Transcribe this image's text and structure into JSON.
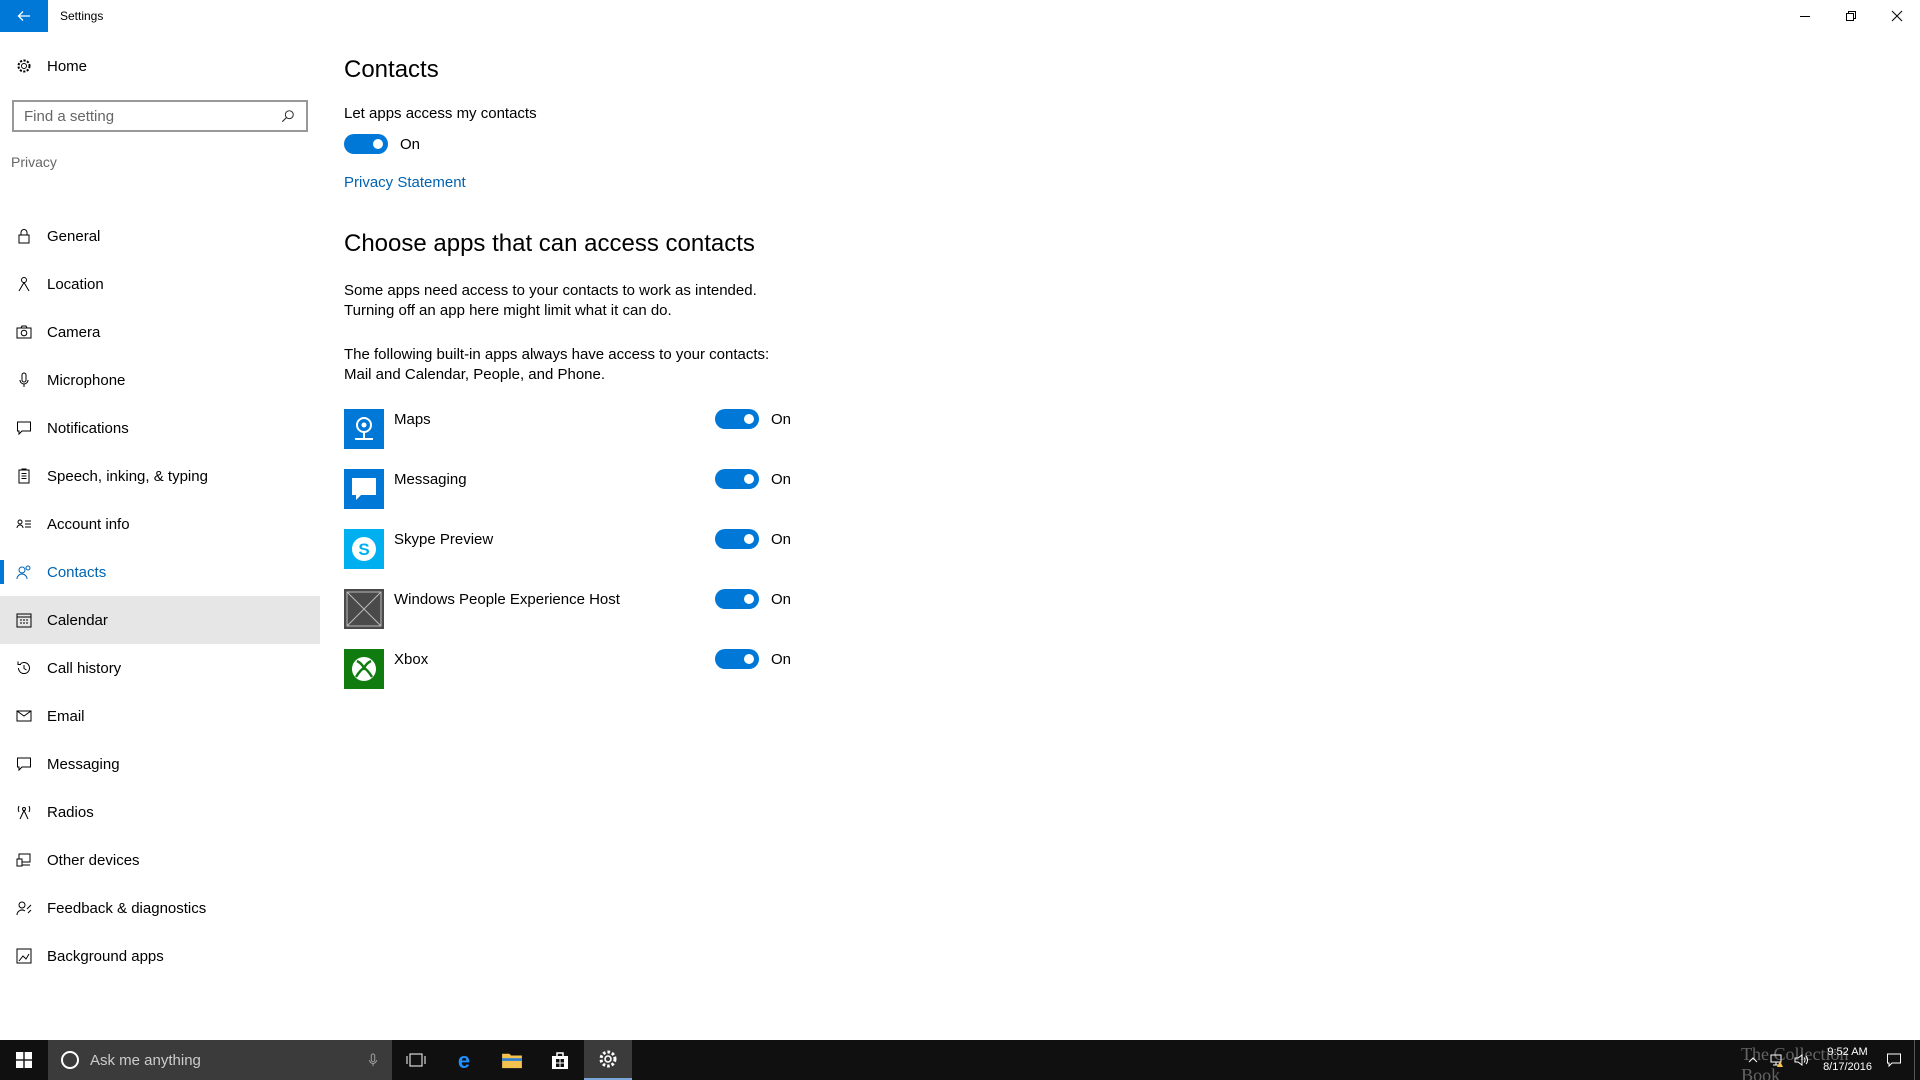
{
  "window": {
    "title": "Settings"
  },
  "sidebar": {
    "home_label": "Home",
    "search_placeholder": "Find a setting",
    "section_label": "Privacy",
    "items": [
      {
        "label": "General",
        "icon": "lock-icon"
      },
      {
        "label": "Location",
        "icon": "location-icon"
      },
      {
        "label": "Camera",
        "icon": "camera-icon"
      },
      {
        "label": "Microphone",
        "icon": "microphone-icon"
      },
      {
        "label": "Notifications",
        "icon": "notifications-icon"
      },
      {
        "label": "Speech, inking, & typing",
        "icon": "clipboard-icon"
      },
      {
        "label": "Account info",
        "icon": "account-info-icon"
      },
      {
        "label": "Contacts",
        "icon": "contacts-icon",
        "selected": true
      },
      {
        "label": "Calendar",
        "icon": "calendar-icon",
        "hovered": true
      },
      {
        "label": "Call history",
        "icon": "history-icon"
      },
      {
        "label": "Email",
        "icon": "mail-icon"
      },
      {
        "label": "Messaging",
        "icon": "message-icon"
      },
      {
        "label": "Radios",
        "icon": "radio-tower-icon"
      },
      {
        "label": "Other devices",
        "icon": "devices-icon"
      },
      {
        "label": "Feedback & diagnostics",
        "icon": "feedback-icon"
      },
      {
        "label": "Background apps",
        "icon": "background-apps-icon"
      }
    ]
  },
  "main": {
    "title": "Contacts",
    "toggle_caption": "Let apps access my contacts",
    "main_toggle_state": "On",
    "privacy_link": "Privacy Statement",
    "section_title": "Choose apps that can access contacts",
    "para1_line1": "Some apps need access to your contacts to work as intended.",
    "para1_line2": "Turning off an app here might limit what it can do.",
    "para2_line1": "The following built-in apps always have access to your contacts:",
    "para2_line2": "Mail and Calendar, People, and Phone.",
    "apps": [
      {
        "name": "Maps",
        "state": "On",
        "icon": "maps-icon",
        "color": "#0078d7"
      },
      {
        "name": "Messaging",
        "state": "On",
        "icon": "messaging-icon",
        "color": "#0078d7"
      },
      {
        "name": "Skype Preview",
        "state": "On",
        "icon": "skype-icon",
        "color": "#00aff0"
      },
      {
        "name": "Windows People Experience Host",
        "state": "On",
        "icon": "placeholder-app-icon",
        "color": "#4a4a4a"
      },
      {
        "name": "Xbox",
        "state": "On",
        "icon": "xbox-icon",
        "color": "#107c10"
      }
    ]
  },
  "taskbar": {
    "search_label": "Ask me anything",
    "time": "9:52 AM",
    "date": "8/17/2016",
    "watermark": "The Collection Book"
  },
  "colors": {
    "accent": "#0078d7",
    "link": "#0063b1",
    "taskbar": "#101010"
  }
}
